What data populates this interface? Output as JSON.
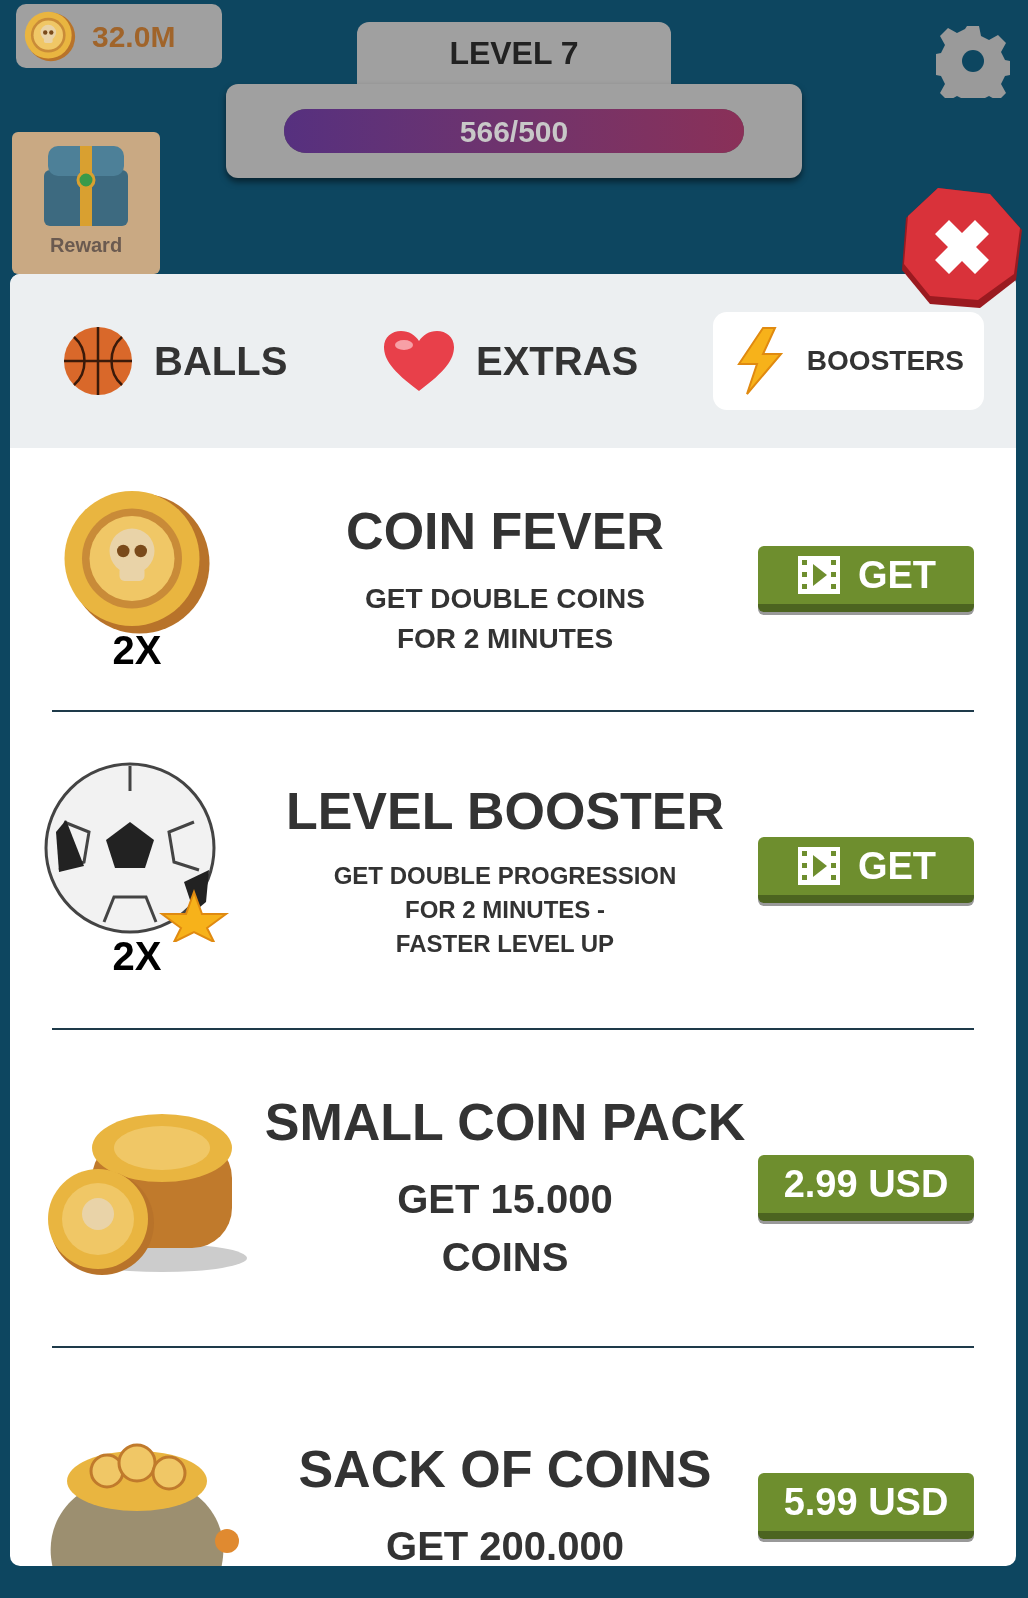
{
  "coins": {
    "amount": "32.0M"
  },
  "level": {
    "title": "LEVEL 7",
    "progress": "566/500",
    "level": 1
  },
  "reward": {
    "label": "Reward"
  },
  "tabs": [
    {
      "label": "BALLS",
      "kind": "ball",
      "selected": false
    },
    {
      "label": "EXTRAS",
      "kind": "heart",
      "selected": false
    },
    {
      "label": "BOOSTERS",
      "kind": "bolt",
      "selected": true
    }
  ],
  "items": [
    {
      "kind": "coin",
      "title": "COIN FEVER",
      "badge": "2X",
      "description": [
        "GET DOUBLE COINS",
        "FOR 2 MINUTES"
      ],
      "button": {
        "kind": "video",
        "label": "GET"
      }
    },
    {
      "kind": "soccer",
      "title": "LEVEL BOOSTER",
      "badge": "2X",
      "description": [
        "GET DOUBLE PROGRESSION",
        "FOR 2 MINUTES -",
        "FASTER LEVEL UP"
      ],
      "button": {
        "kind": "video",
        "label": "GET"
      }
    },
    {
      "kind": "stack",
      "title": "SMALL COIN PACK",
      "description": [
        "GET 15.000",
        "COINS"
      ],
      "button": {
        "kind": "price",
        "label": "2.99 USD"
      }
    },
    {
      "kind": "sack",
      "title": "SACK OF COINS",
      "description": [
        "GET 200.000"
      ],
      "button": {
        "kind": "price",
        "label": "5.99 USD"
      }
    }
  ]
}
